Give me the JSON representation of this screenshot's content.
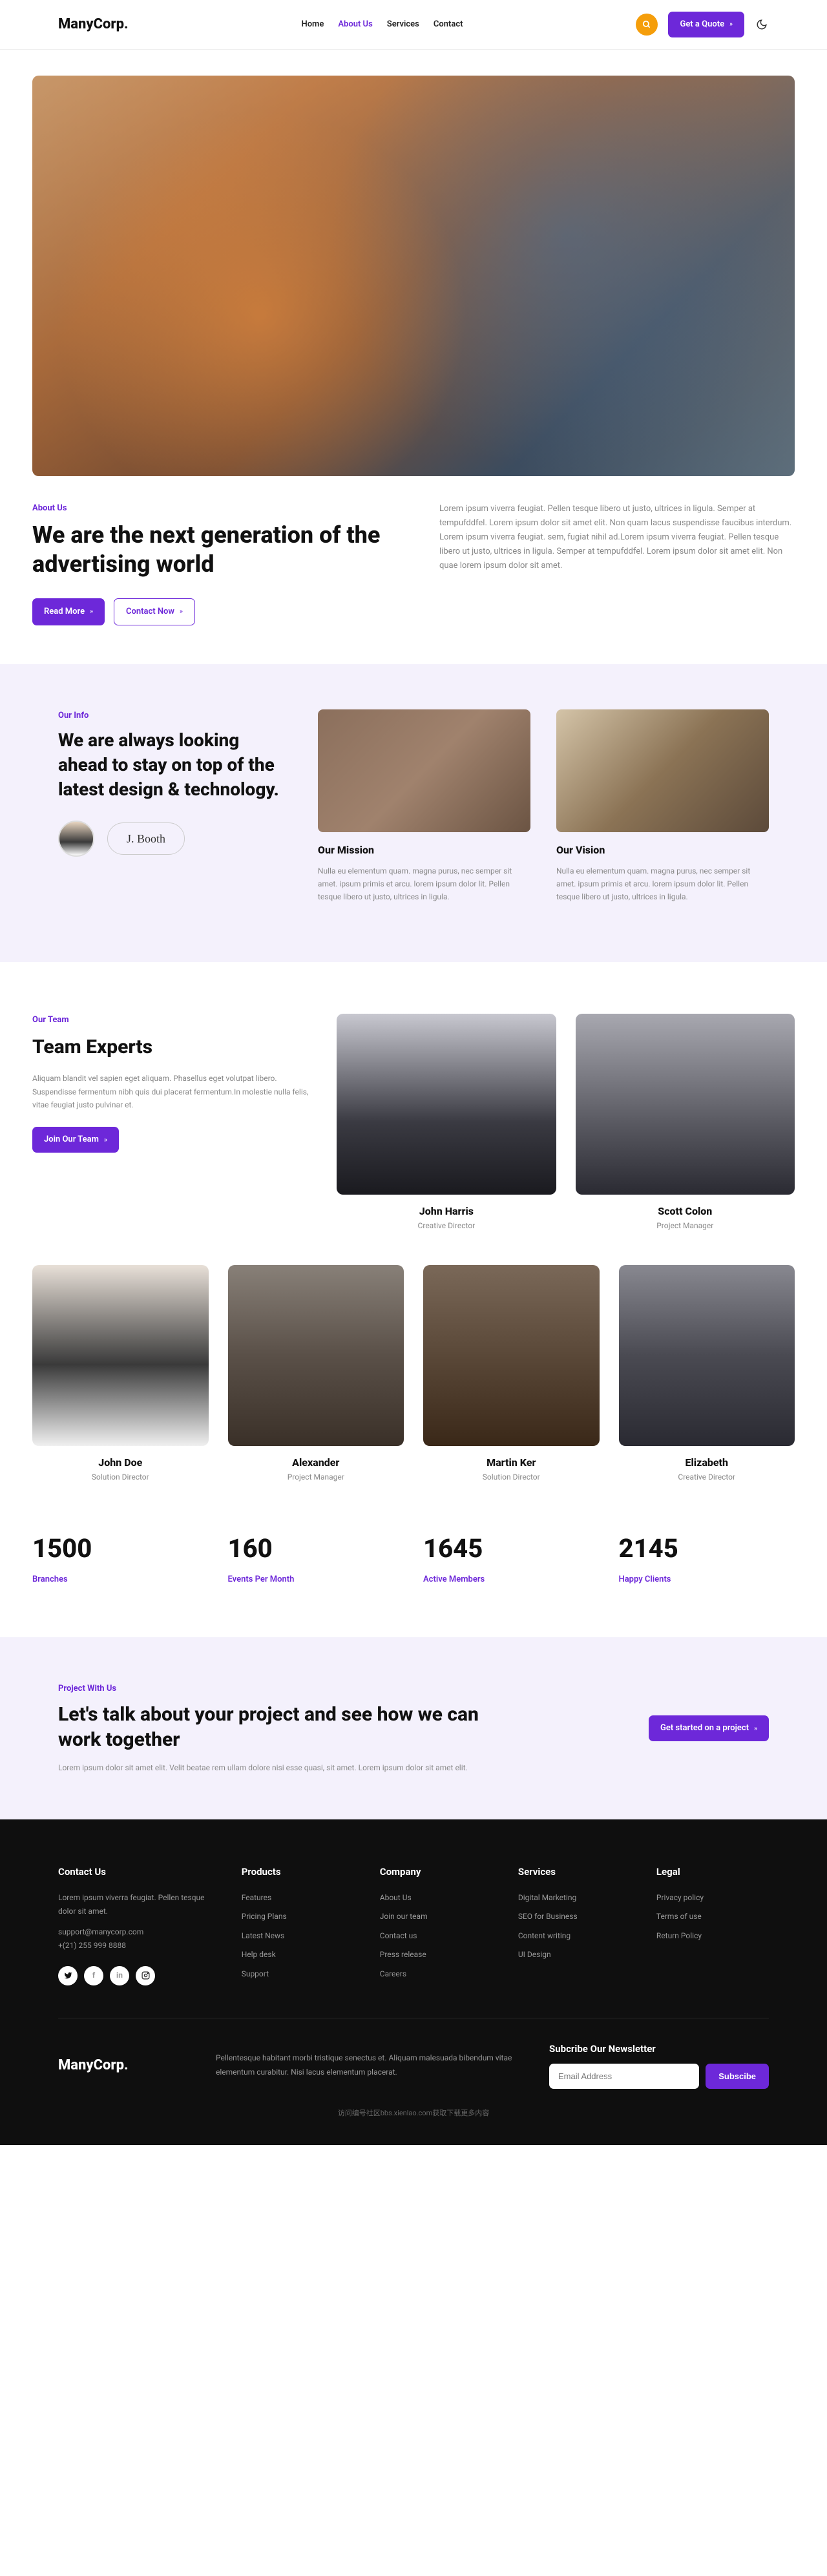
{
  "brand": "ManyCorp.",
  "nav": {
    "home": "Home",
    "about": "About Us",
    "services": "Services",
    "contact": "Contact"
  },
  "header": {
    "quote": "Get a Quote"
  },
  "hero": {
    "eyebrow": "About Us",
    "title": "We are the next generation of the advertising world",
    "text": "Lorem ipsum viverra feugiat. Pellen tesque libero ut justo, ultrices in ligula. Semper at tempufddfel. Lorem ipsum dolor sit amet elit. Non quam lacus suspendisse faucibus interdum. Lorem ipsum viverra feugiat. sem, fugiat nihil ad.Lorem ipsum viverra feugiat. Pellen tesque libero ut justo, ultrices in ligula. Semper at tempufddfel. Lorem ipsum dolor sit amet elit. Non quae lorem ipsum dolor sit amet.",
    "read_more": "Read More",
    "contact_now": "Contact Now"
  },
  "info": {
    "eyebrow": "Our Info",
    "title": "We are always looking ahead to stay on top of the latest design & technology.",
    "signature": "J. Booth",
    "mission_title": "Our Mission",
    "mission_text": "Nulla eu elementum quam. magna purus, nec semper sit amet. ipsum primis et arcu. lorem ipsum dolor lit. Pellen tesque libero ut justo, ultrices in ligula.",
    "vision_title": "Our Vision",
    "vision_text": "Nulla eu elementum quam. magna purus, nec semper sit amet. ipsum primis et arcu. lorem ipsum dolor lit. Pellen tesque libero ut justo, ultrices in ligula."
  },
  "team": {
    "eyebrow": "Our Team",
    "title": "Team Experts",
    "desc": "Aliquam blandit vel sapien eget aliquam. Phasellus eget volutpat libero. Suspendisse fermentum nibh quis dui placerat fermentum.In molestie nulla felis, vitae feugiat justo pulvinar et.",
    "join": "Join Our Team",
    "members": [
      {
        "name": "John Harris",
        "role": "Creative Director"
      },
      {
        "name": "Scott Colon",
        "role": "Project Manager"
      },
      {
        "name": "John Doe",
        "role": "Solution Director"
      },
      {
        "name": "Alexander",
        "role": "Project Manager"
      },
      {
        "name": "Martin Ker",
        "role": "Solution Director"
      },
      {
        "name": "Elizabeth",
        "role": "Creative Director"
      }
    ]
  },
  "counters": [
    {
      "value": "1500",
      "label": "Branches"
    },
    {
      "value": "160",
      "label": "Events Per Month"
    },
    {
      "value": "1645",
      "label": "Active Members"
    },
    {
      "value": "2145",
      "label": "Happy Clients"
    }
  ],
  "cta": {
    "eyebrow": "Project With Us",
    "title": "Let's talk about your project and see how we can work together",
    "text": "Lorem ipsum dolor sit amet elit. Velit beatae rem ullam dolore nisi esse quasi, sit amet. Lorem ipsum dolor sit amet elit.",
    "button": "Get started on a project"
  },
  "footer": {
    "contact_title": "Contact Us",
    "contact_text": "Lorem ipsum viverra feugiat. Pellen tesque dolor sit amet.",
    "email": "support@manycorp.com",
    "phone": "+(21) 255 999 8888",
    "products_title": "Products",
    "products": [
      "Features",
      "Pricing Plans",
      "Latest News",
      "Help desk",
      "Support"
    ],
    "company_title": "Company",
    "company": [
      "About Us",
      "Join our team",
      "Contact us",
      "Press release",
      "Careers"
    ],
    "services_title": "Services",
    "services": [
      "Digital Marketing",
      "SEO for Business",
      "Content writing",
      "UI Design"
    ],
    "legal_title": "Legal",
    "legal": [
      "Privacy policy",
      "Terms of use",
      "Return Policy"
    ],
    "bottom_text": "Pellentesque habitant morbi tristique senectus et. Aliquam malesuada bibendum vitae elementum curabitur. Nisi lacus elementum placerat.",
    "newsletter_title": "Subcribe Our Newsletter",
    "newsletter_placeholder": "Email Address",
    "subscribe": "Subscibe",
    "copyright": "访问编号社区bbs.xienlao.com获取下载更多内容"
  }
}
